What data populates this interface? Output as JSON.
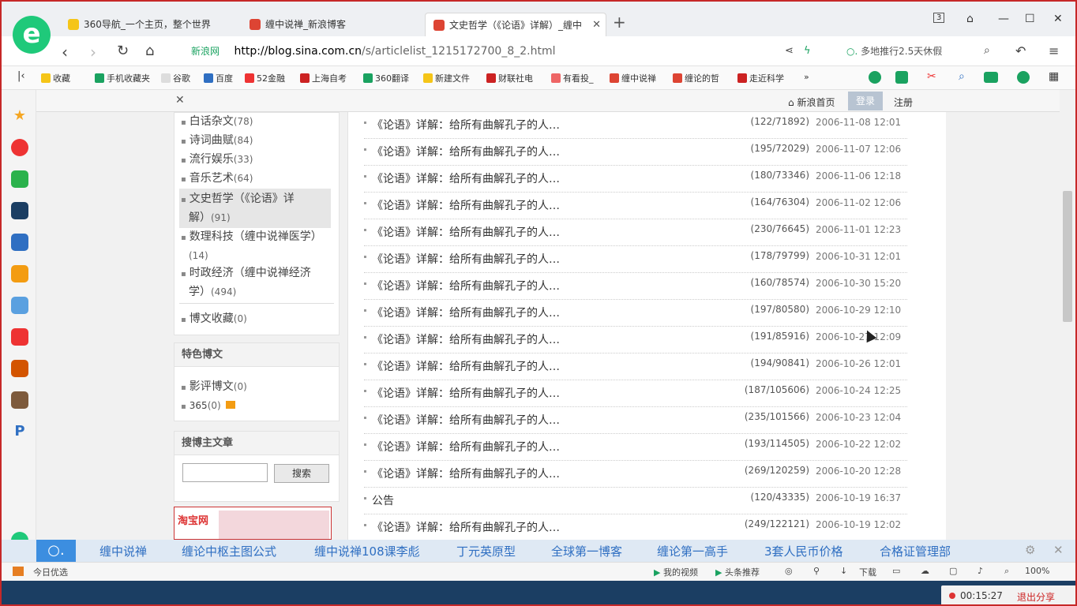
{
  "tabs": [
    {
      "title": "360导航_一个主页，整个世界"
    },
    {
      "title": "缠中说禅_新浪博客"
    },
    {
      "title": "文史哲学（《论语》详解）_缠中"
    }
  ],
  "window": {
    "tab_count": "3"
  },
  "address": {
    "site_label": "新浪网",
    "url_domain": "http://blog.sina.com.cn",
    "url_path": "/s/articlelist_1215172700_8_2.html",
    "search_hint": "多地推行2.5天休假"
  },
  "bookmarks": [
    "收藏",
    "手机收藏夹",
    "谷歌",
    "百度",
    "52金融",
    "上海自考",
    "360翻译",
    "新建文件",
    "财联社电",
    "有看投_",
    "缠中说禅",
    "缠论的哲",
    "走近科学"
  ],
  "sina_nav": {
    "home": "新浪首页",
    "login": "登录",
    "register": "注册"
  },
  "categories": [
    {
      "name": "白话杂文",
      "count": "(78)"
    },
    {
      "name": "诗词曲赋",
      "count": "(84)"
    },
    {
      "name": "流行娱乐",
      "count": "(33)"
    },
    {
      "name": "音乐艺术",
      "count": "(64)"
    },
    {
      "name": "文史哲学（《论语》详",
      "name2": "解）",
      "count": "(91)"
    },
    {
      "name": "数理科技（缠中说禅医学）",
      "count": "(14)"
    },
    {
      "name": "时政经济（缠中说禅经济",
      "name2": "学）",
      "count": "(494)"
    },
    {
      "name": "博文收藏",
      "count": "(0)"
    }
  ],
  "featured": {
    "title": "特色博文",
    "items": [
      {
        "name": "影评博文",
        "count": "(0)"
      },
      {
        "name": "365",
        "count": "(0)"
      }
    ]
  },
  "search_panel": {
    "title": "搜博主文章",
    "button": "搜索"
  },
  "ad": {
    "brand": "淘宝网"
  },
  "articles": [
    {
      "title": "《论语》详解：给所有曲解孔子的人…",
      "stats": "(122/71892)",
      "date": "2006-11-08 12:01"
    },
    {
      "title": "《论语》详解：给所有曲解孔子的人…",
      "stats": "(195/72029)",
      "date": "2006-11-07 12:06"
    },
    {
      "title": "《论语》详解：给所有曲解孔子的人…",
      "stats": "(180/73346)",
      "date": "2006-11-06 12:18"
    },
    {
      "title": "《论语》详解：给所有曲解孔子的人…",
      "stats": "(164/76304)",
      "date": "2006-11-02 12:06"
    },
    {
      "title": "《论语》详解：给所有曲解孔子的人…",
      "stats": "(230/76645)",
      "date": "2006-11-01 12:23"
    },
    {
      "title": "《论语》详解：给所有曲解孔子的人…",
      "stats": "(178/79799)",
      "date": "2006-10-31 12:01"
    },
    {
      "title": "《论语》详解：给所有曲解孔子的人…",
      "stats": "(160/78574)",
      "date": "2006-10-30 15:20"
    },
    {
      "title": "《论语》详解：给所有曲解孔子的人…",
      "stats": "(197/80580)",
      "date": "2006-10-29 12:10"
    },
    {
      "title": "《论语》详解：给所有曲解孔子的人…",
      "stats": "(191/85916)",
      "date": "2006-10-27 12:09"
    },
    {
      "title": "《论语》详解：给所有曲解孔子的人…",
      "stats": "(194/90841)",
      "date": "2006-10-26 12:01"
    },
    {
      "title": "《论语》详解：给所有曲解孔子的人…",
      "stats": "(187/105606)",
      "date": "2006-10-24 12:25"
    },
    {
      "title": "《论语》详解：给所有曲解孔子的人…",
      "stats": "(235/101566)",
      "date": "2006-10-23 12:04"
    },
    {
      "title": "《论语》详解：给所有曲解孔子的人…",
      "stats": "(193/114505)",
      "date": "2006-10-22 12:02"
    },
    {
      "title": "《论语》详解：给所有曲解孔子的人…",
      "stats": "(269/120259)",
      "date": "2006-10-20 12:28"
    },
    {
      "title": "公告",
      "stats": "(120/43335)",
      "date": "2006-10-19 16:37"
    },
    {
      "title": "《论语》详解：给所有曲解孔子的人…",
      "stats": "(249/122121)",
      "date": "2006-10-19 12:02"
    }
  ],
  "hot_searches": [
    "缠中说禅",
    "缠论中枢主图公式",
    "缠中说禅108课李彪",
    "丁元英原型",
    "全球第一博客",
    "缠论第一高手",
    "3套人民币价格",
    "合格证管理部"
  ],
  "status": {
    "daily": "今日优选",
    "video": "我的视频",
    "news": "头条推荐",
    "download": "下载",
    "zoom": "100%"
  },
  "recording": {
    "time": "00:15:27",
    "exit": "退出分享"
  }
}
